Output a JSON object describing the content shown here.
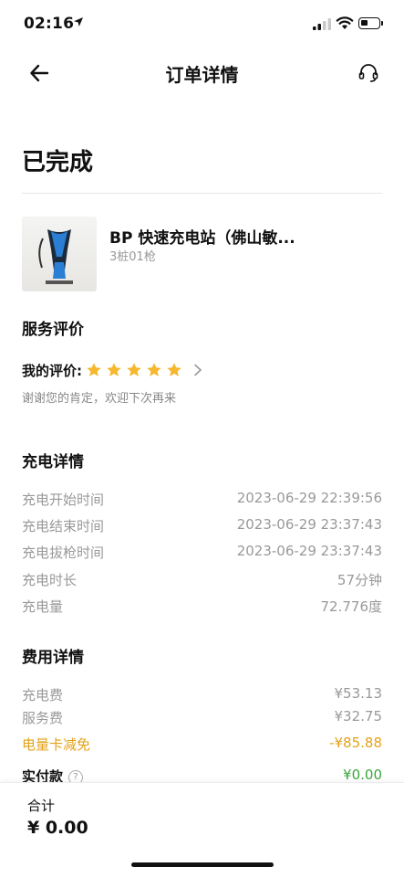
{
  "status_bar": {
    "time": "02:16"
  },
  "nav": {
    "title": "订单详情"
  },
  "order": {
    "status": "已完成"
  },
  "station": {
    "name": "BP 快速充电站（佛山敏...",
    "sub": "3桩01枪"
  },
  "rating": {
    "section_title": "服务评价",
    "label": "我的评价:",
    "stars": 5,
    "star_color": "#f5b82e",
    "thanks": "谢谢您的肯定，欢迎下次再来"
  },
  "charge": {
    "section_title": "充电详情",
    "rows": [
      {
        "label": "充电开始时间",
        "value": "2023-06-29 22:39:56"
      },
      {
        "label": "充电结束时间",
        "value": "2023-06-29 23:37:43"
      },
      {
        "label": "充电拔枪时间",
        "value": "2023-06-29 23:37:43"
      },
      {
        "label": "充电时长",
        "value": "57分钟"
      },
      {
        "label": "充电量",
        "value": "72.776度"
      }
    ]
  },
  "fee": {
    "section_title": "费用详情",
    "rows": [
      {
        "label": "充电费",
        "value": "¥53.13"
      },
      {
        "label": "服务费",
        "value": "¥32.75"
      },
      {
        "label": "电量卡减免",
        "value": "-¥85.88"
      },
      {
        "label": "实付款",
        "value": "¥0.00"
      }
    ],
    "discount_color": "#e3a21a",
    "paid_color": "#3aa53a"
  },
  "bottom": {
    "total_label": "合计",
    "total_value": "¥ 0.00"
  }
}
